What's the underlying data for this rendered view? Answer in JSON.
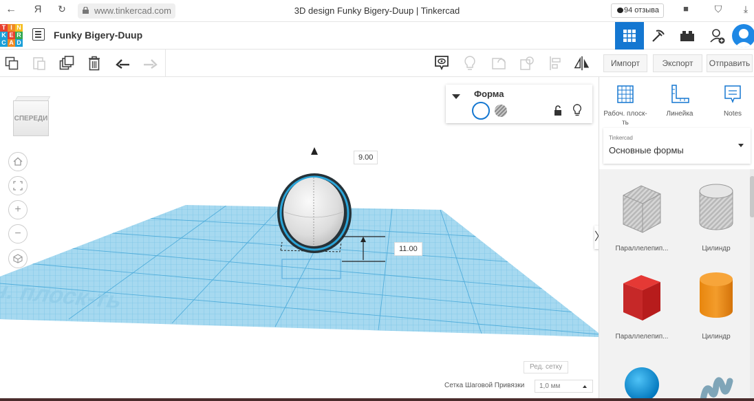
{
  "browser": {
    "url": "www.tinkercad.com",
    "tab_title": "3D design Funky Bigery-Duup | Tinkercad",
    "reviews_label": "94 отзыва"
  },
  "app": {
    "logo_letters": [
      "T",
      "I",
      "N",
      "K",
      "E",
      "R",
      "C",
      "A",
      "D"
    ],
    "logo_colors": [
      "#e8412f",
      "#f08a24",
      "#f6be1d",
      "#1b9fd8",
      "#e8412f",
      "#34a853",
      "#1b9fd8",
      "#f08a24",
      "#1b9fd8"
    ],
    "design_name": "Funky Bigery-Duup",
    "accent": "#1477d1"
  },
  "actions": {
    "import": "Импорт",
    "export": "Экспорт",
    "send": "Отправить"
  },
  "viewcube_label": "СПЕРЕДИ",
  "shape_panel": {
    "title": "Форма"
  },
  "dimensions": {
    "height": "9.00",
    "elevation": "11.00"
  },
  "workplane_watermark": "Рабоч. плоск-ть",
  "snap": {
    "edit_grid": "Ред. сетку",
    "label": "Сетка Шаговой Привязки",
    "value": "1,0 мм"
  },
  "right_tools": [
    {
      "label": "Рабоч. плоск-ть",
      "icon": "workplane-icon"
    },
    {
      "label": "Линейка",
      "icon": "ruler-icon"
    },
    {
      "label": "Notes",
      "icon": "notes-icon"
    }
  ],
  "library": {
    "source": "Tinkercad",
    "category": "Основные формы"
  },
  "shapes": [
    {
      "name": "Параллелепип...",
      "kind": "box-hole"
    },
    {
      "name": "Цилиндр",
      "kind": "cylinder-hole"
    },
    {
      "name": "Параллелепип...",
      "kind": "box"
    },
    {
      "name": "Цилиндр",
      "kind": "cylinder"
    },
    {
      "name": "",
      "kind": "sphere"
    },
    {
      "name": "",
      "kind": "scribble"
    }
  ]
}
